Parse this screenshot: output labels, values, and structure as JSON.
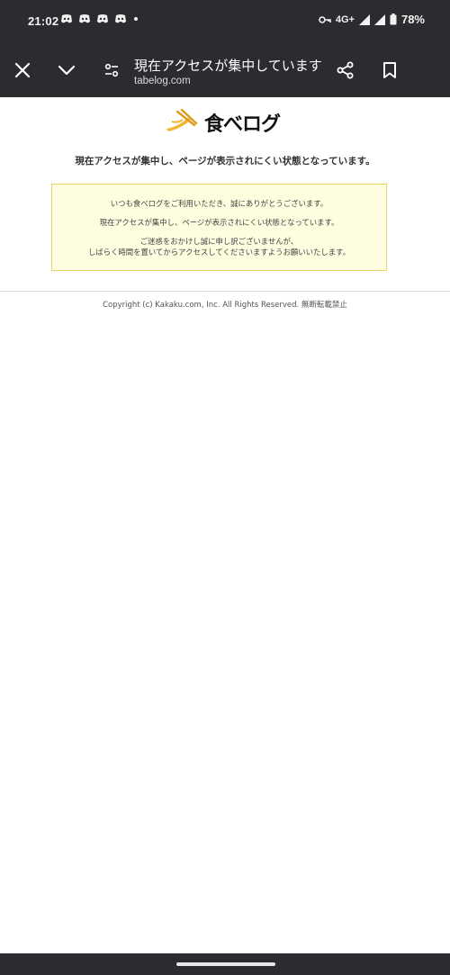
{
  "status_bar": {
    "time": "21:02",
    "network": "4G+",
    "battery": "78%",
    "notification_icons": [
      "discord-icon",
      "discord-icon",
      "discord-icon",
      "discord-icon"
    ]
  },
  "toolbar": {
    "title": "現在アクセスが集中しています [...",
    "url": "tabelog.com",
    "icons": [
      "close-icon",
      "chevron-down-icon",
      "page-controls-icon",
      "share-icon",
      "bookmark-icon"
    ]
  },
  "page": {
    "logo_text": "食べログ",
    "headline": "現在アクセスが集中し、ページが表示されにくい状態となっています。",
    "notice": {
      "line1": "いつも食べログをご利用いただき、誠にありがとうございます。",
      "line2": "現在アクセスが集中し、ページが表示されにくい状態となっています。",
      "line3a": "ご迷惑をおかけし誠に申し訳ございませんが、",
      "line3b": "しばらく時間を置いてからアクセスしてくださいますようお願いいたします。"
    },
    "copyright": "Copyright (c) Kakaku.com, Inc. All Rights Reserved. 無断転載禁止"
  },
  "colors": {
    "chrome": "#2b2c2f",
    "notice_bg": "#fffddf",
    "notice_border": "#e6d56a",
    "logo_accent": "#f2b632"
  }
}
